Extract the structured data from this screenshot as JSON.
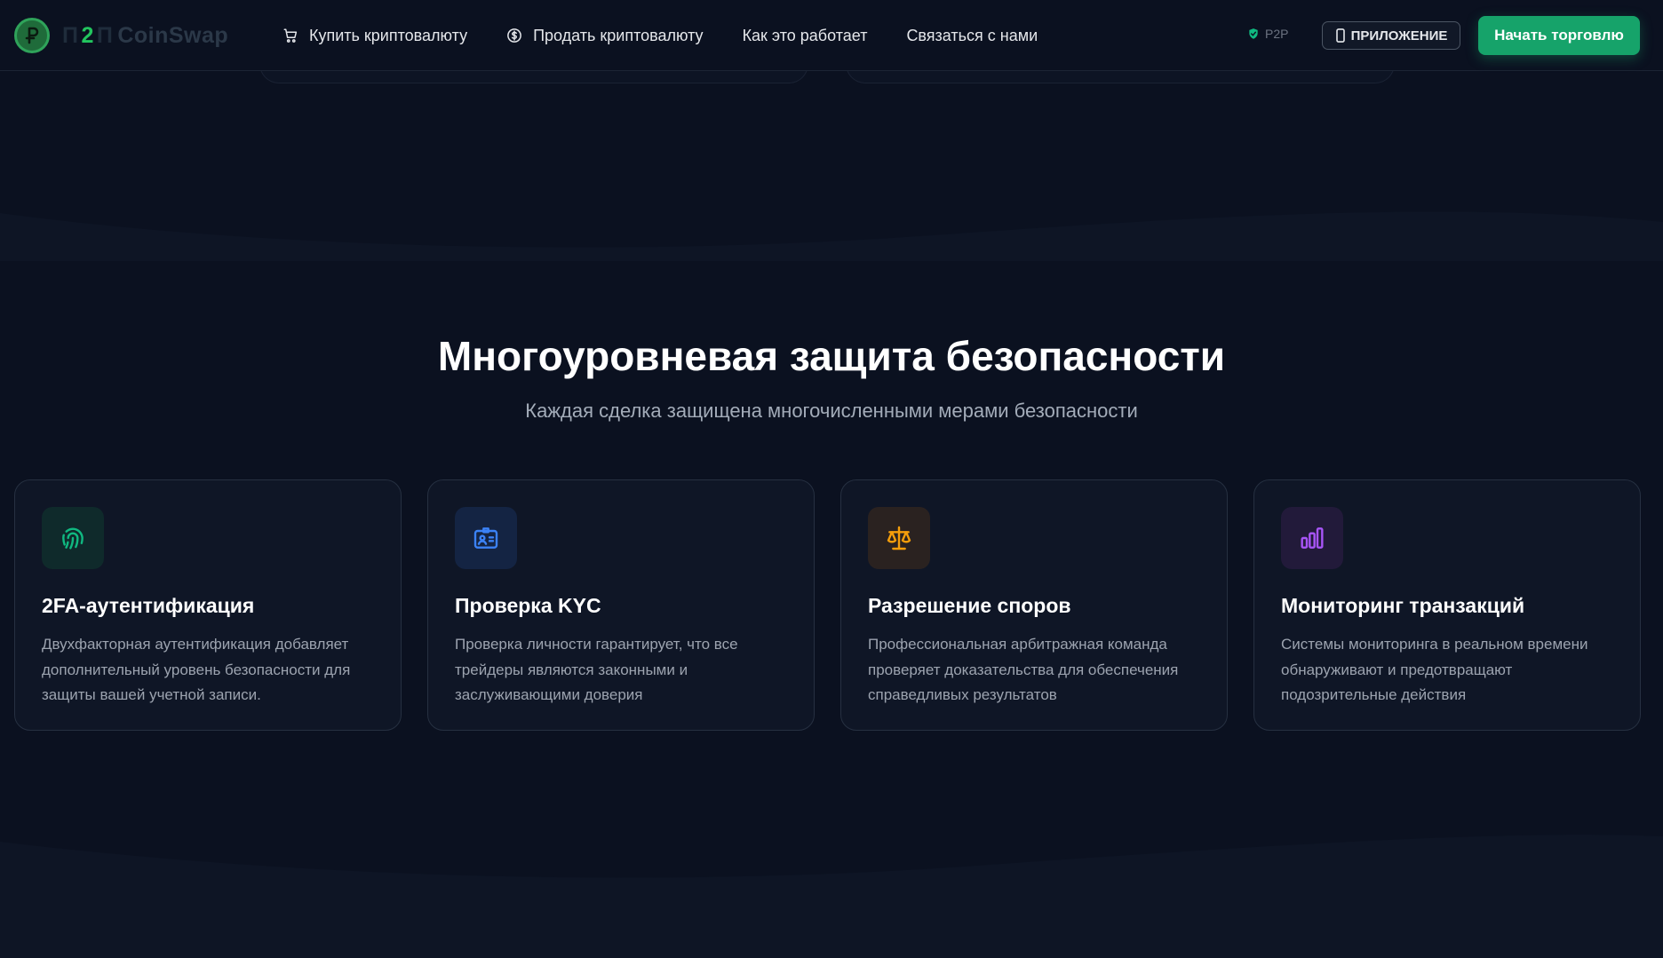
{
  "header": {
    "logo": {
      "letters": [
        "П",
        "2",
        "П"
      ],
      "brand": "CoinSwap"
    },
    "nav": [
      {
        "label": "Купить криптовалюту",
        "icon": "cart-icon"
      },
      {
        "label": "Продать криптовалюту",
        "icon": "dollar-circle-icon"
      },
      {
        "label": "Как это работает"
      },
      {
        "label": "Связаться с нами"
      }
    ],
    "p2p_badge": "P2P",
    "app_button": "ПРИЛОЖЕНИЕ",
    "cta_button": "Начать торговлю"
  },
  "security": {
    "title": "Многоуровневая защита безопасности",
    "subtitle": "Каждая сделка защищена многочисленными мерами безопасности",
    "cards": [
      {
        "icon": "fingerprint-icon",
        "title": "2FA-аутентификация",
        "description": "Двухфакторная аутентификация добавляет дополнительный уровень безопасности для защиты вашей учетной записи."
      },
      {
        "icon": "id-card-icon",
        "title": "Проверка KYC",
        "description": "Проверка личности гарантирует, что все трейдеры являются законными и заслуживающими доверия"
      },
      {
        "icon": "scales-icon",
        "title": "Разрешение споров",
        "description": "Профессиональная арбитражная команда проверяет доказательства для обеспечения справедливых результатов"
      },
      {
        "icon": "bar-chart-icon",
        "title": "Мониторинг транзакций",
        "description": "Системы мониторинга в реальном времени обнаруживают и предотвращают подозрительные действия"
      }
    ]
  },
  "colors": {
    "background": "#0b1120",
    "accent": "#16a36a",
    "fingerprint": "#10b981",
    "id_card": "#3b82f6",
    "scales": "#f59e0b",
    "chart": "#a855f7"
  }
}
